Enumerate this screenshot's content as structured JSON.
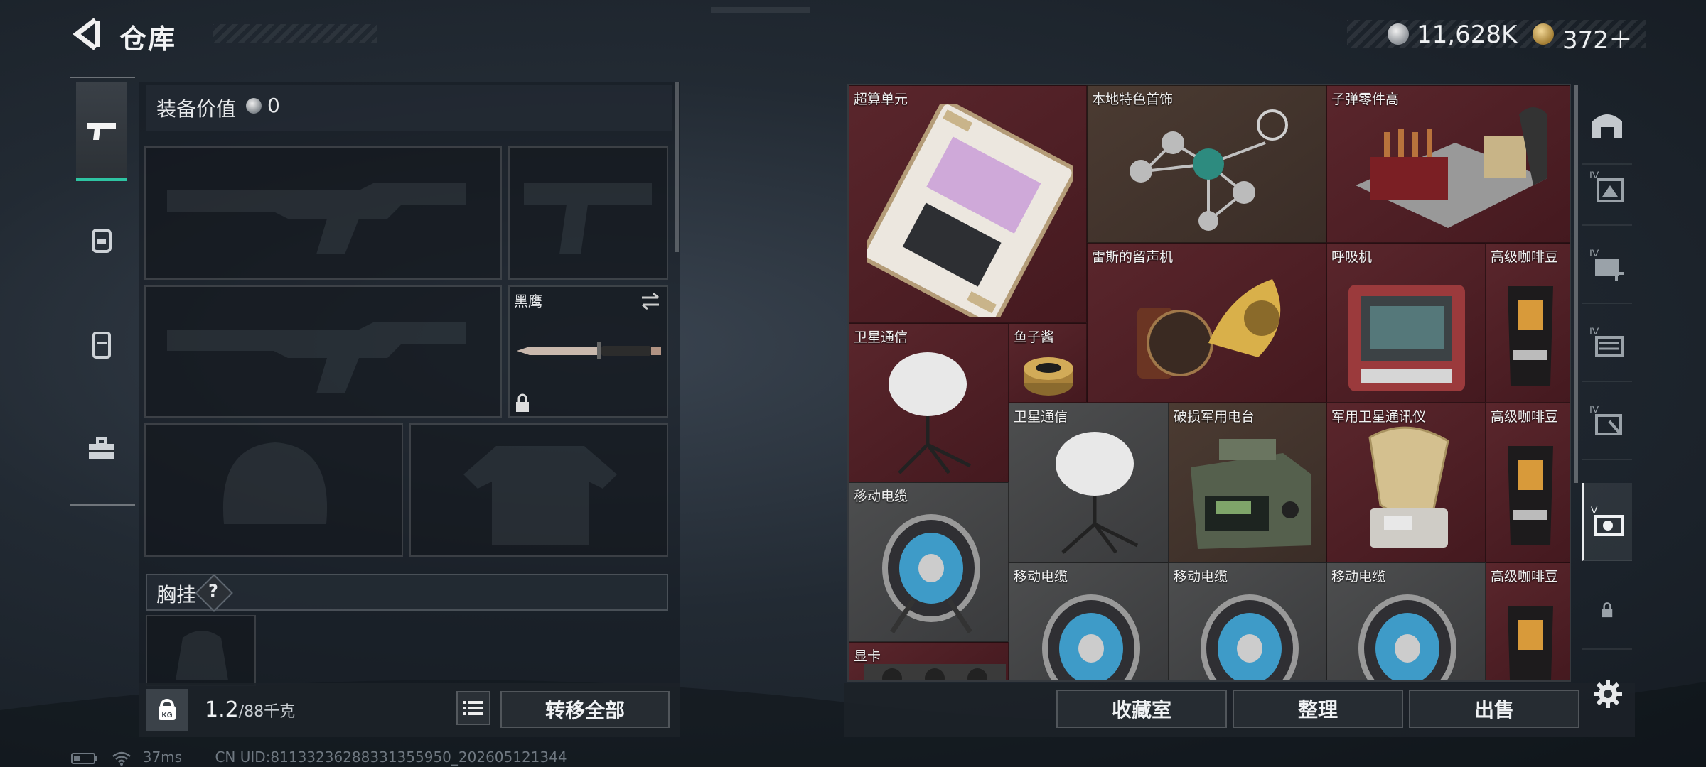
{
  "header": {
    "title": "仓库"
  },
  "currency": {
    "silver": "11,628K",
    "gold": "372＋"
  },
  "loadout": {
    "equip_value_label": "装备价值",
    "equip_value": "0",
    "knife_label": "黑鹰",
    "chest_rig_label": "胸挂",
    "help_glyph": "?"
  },
  "bottom_left": {
    "weight_value": "1.2",
    "weight_capacity": "/88千克",
    "kg_icon_text": "KG",
    "transfer_all": "转移全部"
  },
  "stash": {
    "items": [
      {
        "label": "超算单元",
        "icon": "supercomputer-board-icon",
        "bg": "red"
      },
      {
        "label": "本地特色首饰",
        "icon": "jewelry-icon",
        "bg": "brown"
      },
      {
        "label": "子弹零件高",
        "icon": "bullet-parts-box-icon",
        "bg": "red"
      },
      {
        "label": "雷斯的留声机",
        "icon": "gramophone-icon",
        "bg": "red"
      },
      {
        "label": "呼吸机",
        "icon": "ventilator-icon",
        "bg": "red"
      },
      {
        "label": "高级咖啡豆",
        "icon": "coffee-bag-icon",
        "bg": "red"
      },
      {
        "label": "卫星通信",
        "icon": "satellite-dish-icon",
        "bg": "red"
      },
      {
        "label": "鱼子酱",
        "icon": "caviar-tin-icon",
        "bg": "red"
      },
      {
        "label": "卫星通信",
        "icon": "satellite-dish-icon",
        "bg": "red"
      },
      {
        "label": "破损军用电台",
        "icon": "military-radio-icon",
        "bg": "brown"
      },
      {
        "label": "军用卫星通讯仪",
        "icon": "satellite-antenna-icon",
        "bg": "red"
      },
      {
        "label": "高级咖啡豆",
        "icon": "coffee-bag-icon",
        "bg": "red"
      },
      {
        "label": "移动电缆",
        "icon": "cable-reel-icon",
        "bg": "grey"
      },
      {
        "label": "移动电缆",
        "icon": "cable-reel-icon",
        "bg": "grey"
      },
      {
        "label": "移动电缆",
        "icon": "cable-reel-icon",
        "bg": "grey"
      },
      {
        "label": "移动电缆",
        "icon": "cable-reel-icon",
        "bg": "grey"
      },
      {
        "label": "高级咖啡豆",
        "icon": "coffee-bag-icon",
        "bg": "red"
      },
      {
        "label": "显卡",
        "icon": "graphics-card-icon",
        "bg": "red"
      }
    ]
  },
  "bottom_right": {
    "collection": "收藏室",
    "organize": "整理",
    "sell": "出售"
  },
  "status": {
    "ping": "37ms",
    "uid": "CN UID:81133236288331355950_202605121344"
  },
  "colors": {
    "accent": "#2ec4a2",
    "item_red": "#4e1f25",
    "item_brown": "#3f322b",
    "item_grey": "#434446"
  }
}
